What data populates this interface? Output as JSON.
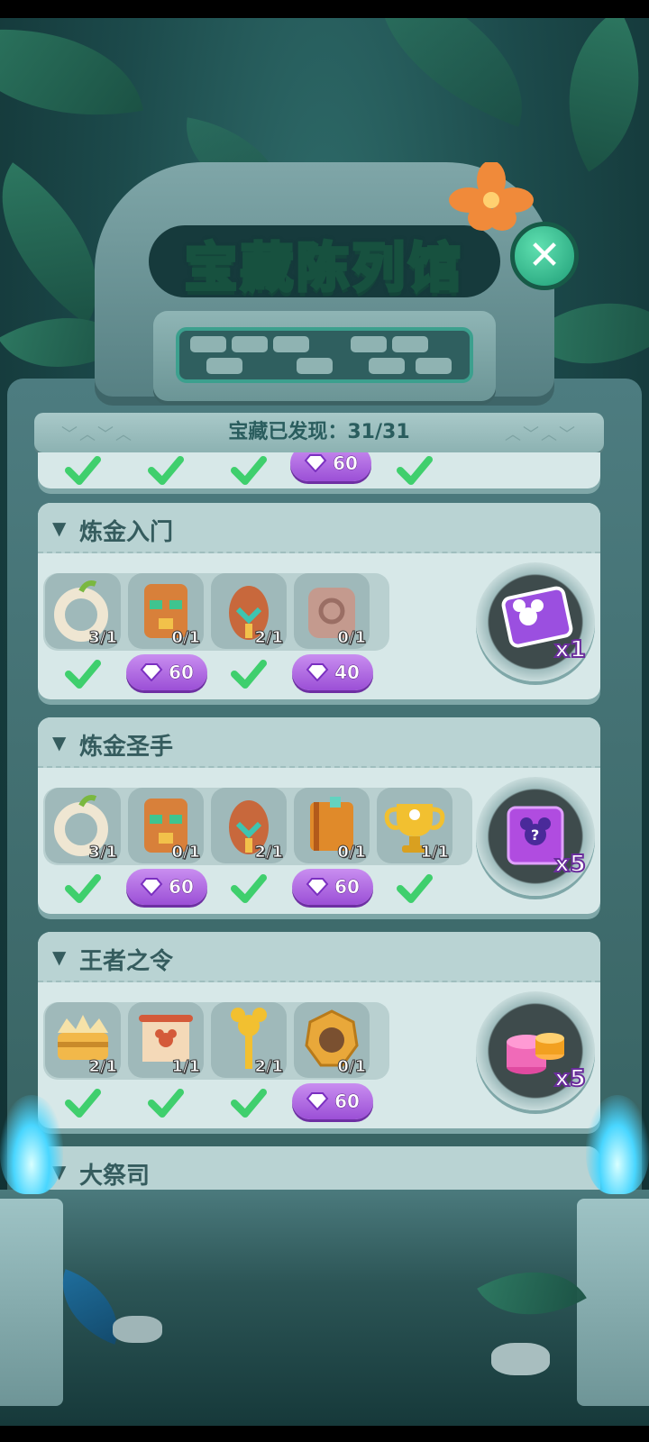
{
  "title": "宝藏陈列馆",
  "counter": {
    "label": "宝藏已发现：31/31"
  },
  "close_label": "✕",
  "colors": {
    "accent": "#4fe3b6",
    "gem": "#b266e8",
    "check": "#3fcf6d",
    "card": "#d7e8e8"
  },
  "top_partial_row": {
    "items": [
      {
        "status": "check"
      },
      {
        "status": "check"
      },
      {
        "status": "check"
      },
      {
        "status": "gem",
        "cost": "60"
      },
      {
        "status": "check"
      }
    ]
  },
  "sections": [
    {
      "name": "炼金入门",
      "items": [
        {
          "icon": "bone-ring-icon",
          "count": "3/1",
          "status": "check"
        },
        {
          "icon": "tiki-mask-icon",
          "count": "0/1",
          "status": "gem",
          "cost": "60"
        },
        {
          "icon": "tribal-shield-icon",
          "count": "2/1",
          "status": "check"
        },
        {
          "icon": "stone-tablet-icon",
          "count": "0/1",
          "status": "gem",
          "cost": "40"
        }
      ],
      "reward": {
        "icon": "mickey-card-icon",
        "qty": "x1"
      }
    },
    {
      "name": "炼金圣手",
      "items": [
        {
          "icon": "bone-ring-icon",
          "count": "3/1",
          "status": "check"
        },
        {
          "icon": "tiki-mask-icon",
          "count": "0/1",
          "status": "gem",
          "cost": "60"
        },
        {
          "icon": "tribal-shield-icon",
          "count": "2/1",
          "status": "check"
        },
        {
          "icon": "ancient-book-icon",
          "count": "0/1",
          "status": "gem",
          "cost": "60"
        },
        {
          "icon": "golden-trophy-icon",
          "count": "1/1",
          "status": "check"
        }
      ],
      "reward": {
        "icon": "mystery-ticket-icon",
        "qty": "x5"
      }
    },
    {
      "name": "王者之令",
      "items": [
        {
          "icon": "crown-icon",
          "count": "2/1",
          "status": "check"
        },
        {
          "icon": "scroll-icon",
          "count": "1/1",
          "status": "check"
        },
        {
          "icon": "golden-scepter-icon",
          "count": "2/1",
          "status": "check"
        },
        {
          "icon": "golden-medal-icon",
          "count": "0/1",
          "status": "gem",
          "cost": "60"
        }
      ],
      "reward": {
        "icon": "coin-stack-icon",
        "qty": "x5"
      }
    },
    {
      "name": "大祭司"
    }
  ]
}
